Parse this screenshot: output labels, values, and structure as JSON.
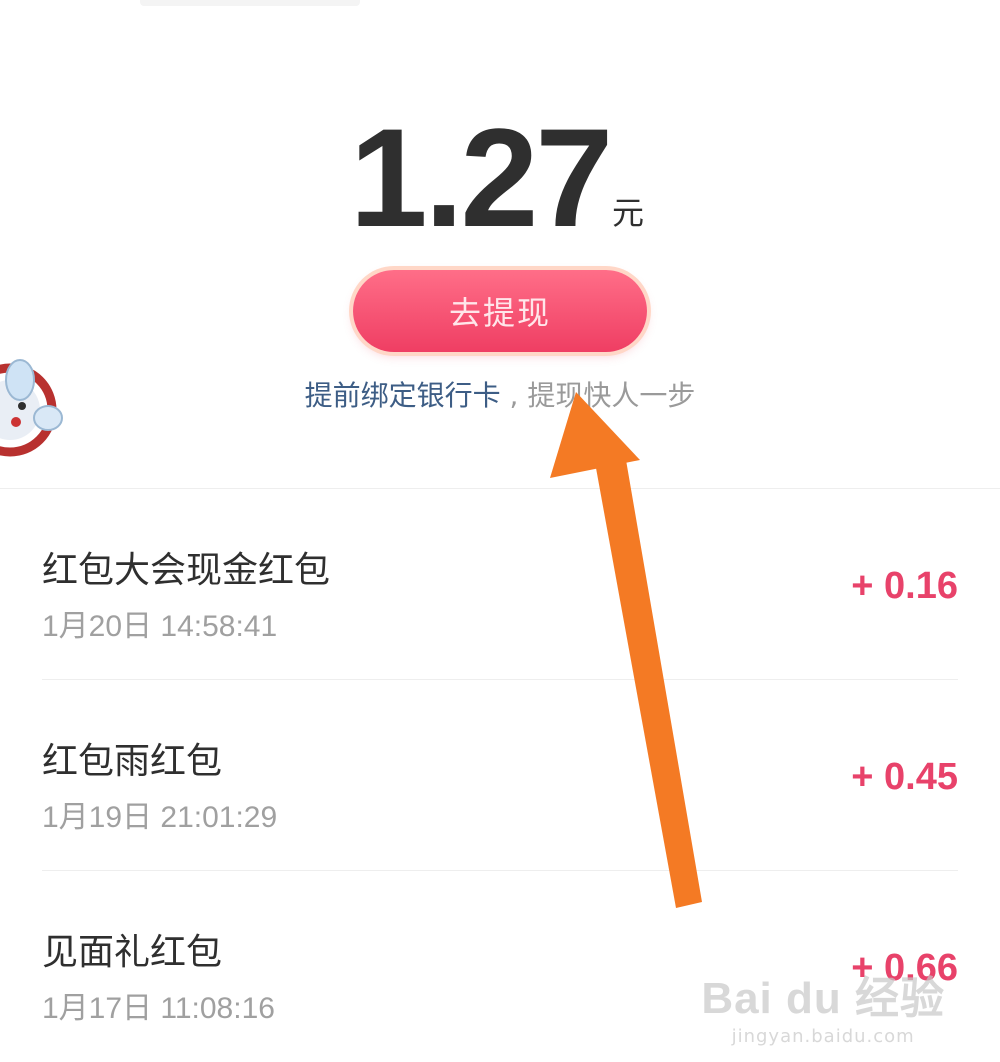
{
  "balance": {
    "amount": "1.27",
    "unit": "元"
  },
  "withdraw": {
    "button_label": "去提现"
  },
  "tip": {
    "link_text": "提前绑定银行卡",
    "separator": " , ",
    "text": "提现快人一步"
  },
  "records": [
    {
      "title": "红包大会现金红包",
      "time": "1月20日 14:58:41",
      "amount": "+ 0.16"
    },
    {
      "title": "红包雨红包",
      "time": "1月19日 21:01:29",
      "amount": "+ 0.45"
    },
    {
      "title": "见面礼红包",
      "time": "1月17日 11:08:16",
      "amount": "+ 0.66"
    }
  ],
  "watermark": {
    "logo": "Bai du 经验",
    "url": "jingyan.baidu.com"
  },
  "colors": {
    "accent": "#e8426a",
    "button": "#ef3e63",
    "link": "#3d5d85",
    "arrow": "#f47a24"
  },
  "icons": {
    "mascot": "mascot-icon",
    "arrow": "orange-arrow-annotation"
  }
}
